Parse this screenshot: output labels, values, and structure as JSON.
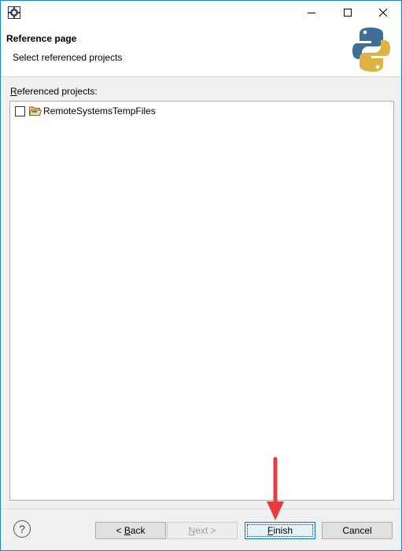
{
  "window": {
    "icon": "eclipse-gear-icon",
    "minimize_icon": "minimize-icon",
    "maximize_icon": "maximize-icon",
    "close_icon": "close-icon"
  },
  "header": {
    "title": "Reference page",
    "description": "Select referenced projects",
    "logo": "python-logo"
  },
  "list": {
    "label_accel": "R",
    "label_rest": "eferenced projects:",
    "items": [
      {
        "label": "RemoteSystemsTempFiles",
        "checked": false,
        "icon": "open-folder-icon"
      }
    ]
  },
  "footer": {
    "help_label": "?",
    "back_prefix": "< ",
    "back_accel": "B",
    "back_rest": "ack",
    "next_accel": "N",
    "next_rest": "ext >",
    "finish_accel": "F",
    "finish_rest": "inish",
    "cancel_label": "Cancel"
  },
  "annotation": {
    "arrow_color": "#e8393f",
    "target": "finish-button"
  },
  "colors": {
    "window_border": "#1883d7",
    "default_button_border": "#0078d7",
    "logo_blue": "#3f6e96",
    "logo_yellow": "#dcb443"
  }
}
